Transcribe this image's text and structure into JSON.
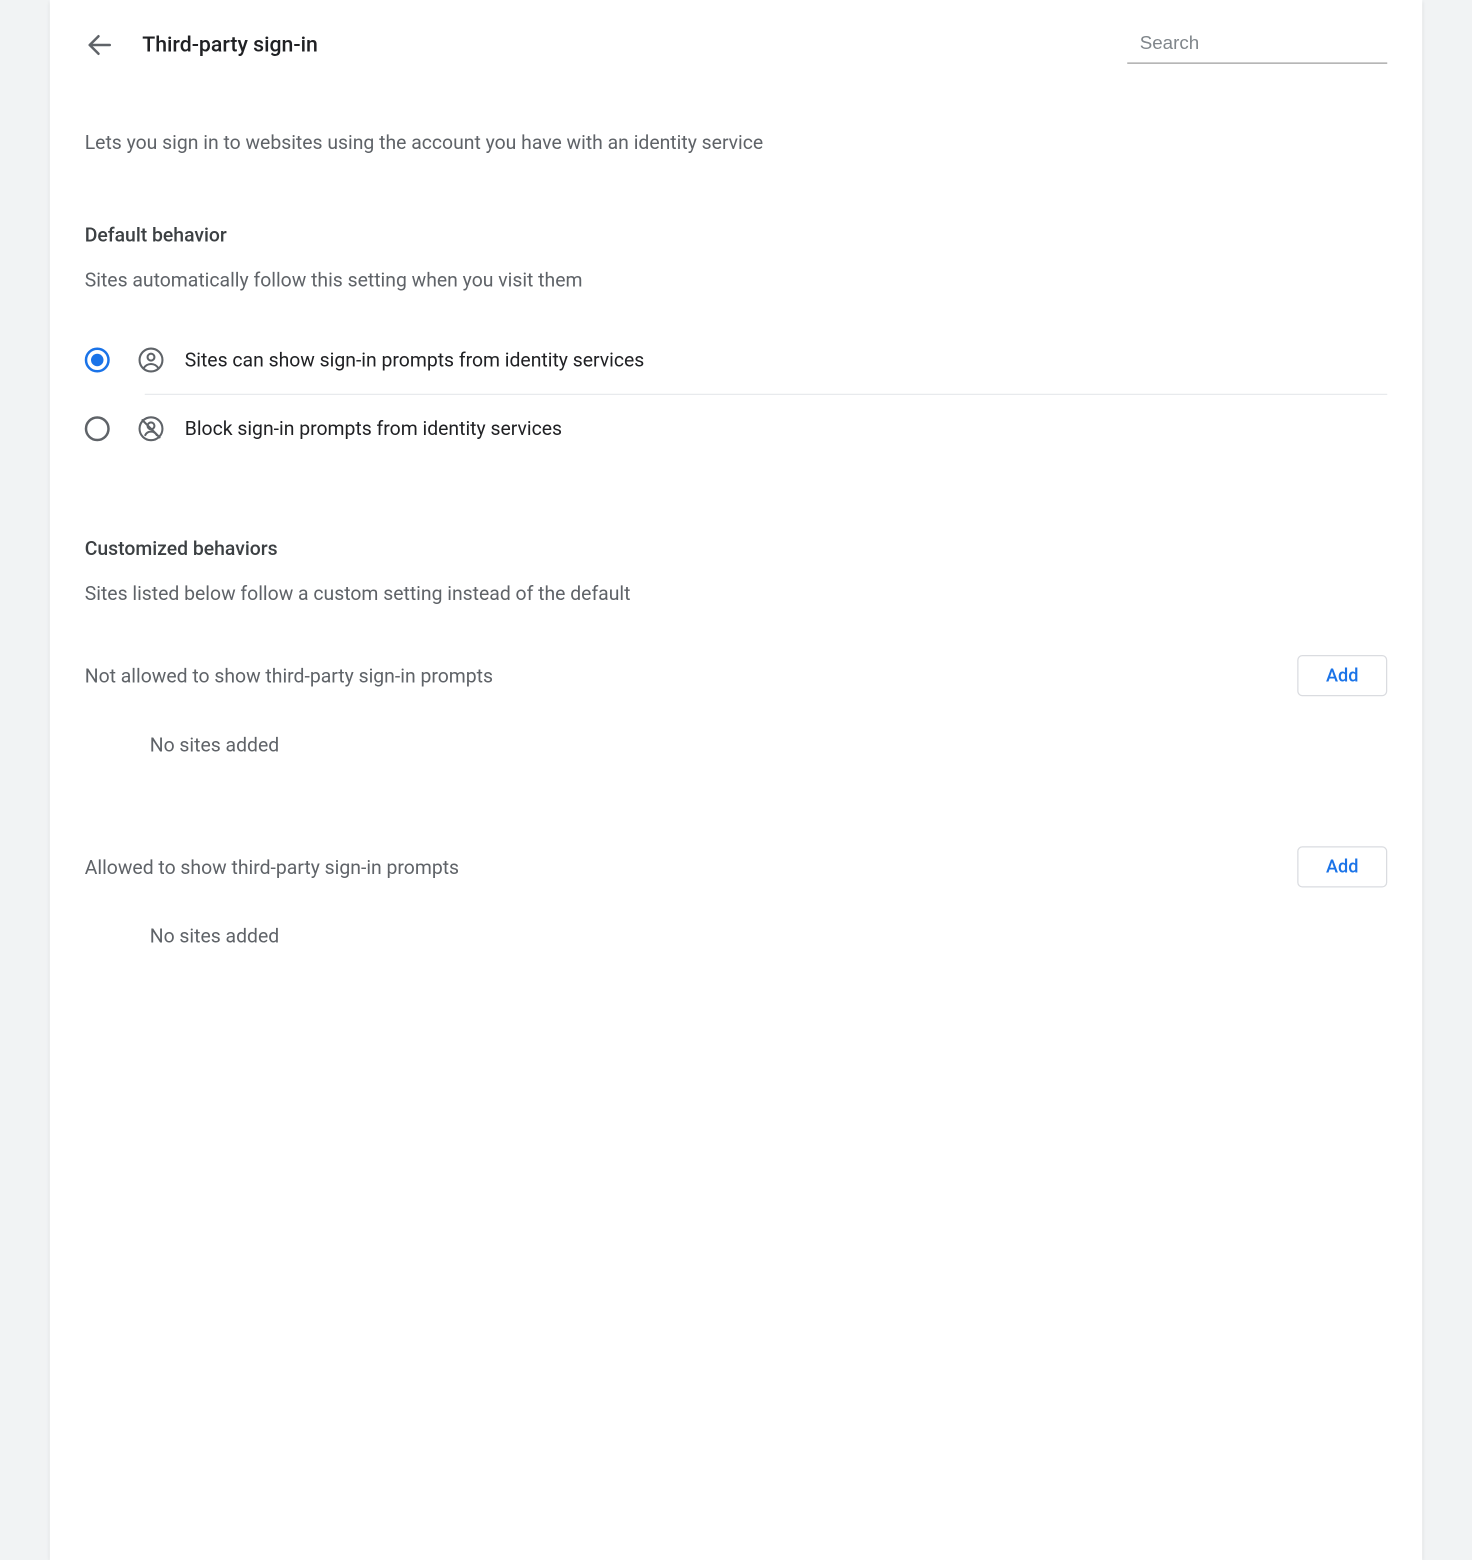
{
  "header": {
    "title": "Third-party sign-in",
    "search_placeholder": "Search"
  },
  "description": "Lets you sign in to websites using the account you have with an identity service",
  "default_behavior": {
    "title": "Default behavior",
    "subtitle": "Sites automatically follow this setting when you visit them",
    "options": [
      {
        "label": "Sites can show sign-in prompts from identity services",
        "selected": true
      },
      {
        "label": "Block sign-in prompts from identity services",
        "selected": false
      }
    ]
  },
  "customized": {
    "title": "Customized behaviors",
    "subtitle": "Sites listed below follow a custom setting instead of the default",
    "not_allowed": {
      "label": "Not allowed to show third-party sign-in prompts",
      "add_label": "Add",
      "empty": "No sites added"
    },
    "allowed": {
      "label": "Allowed to show third-party sign-in prompts",
      "add_label": "Add",
      "empty": "No sites added"
    }
  }
}
